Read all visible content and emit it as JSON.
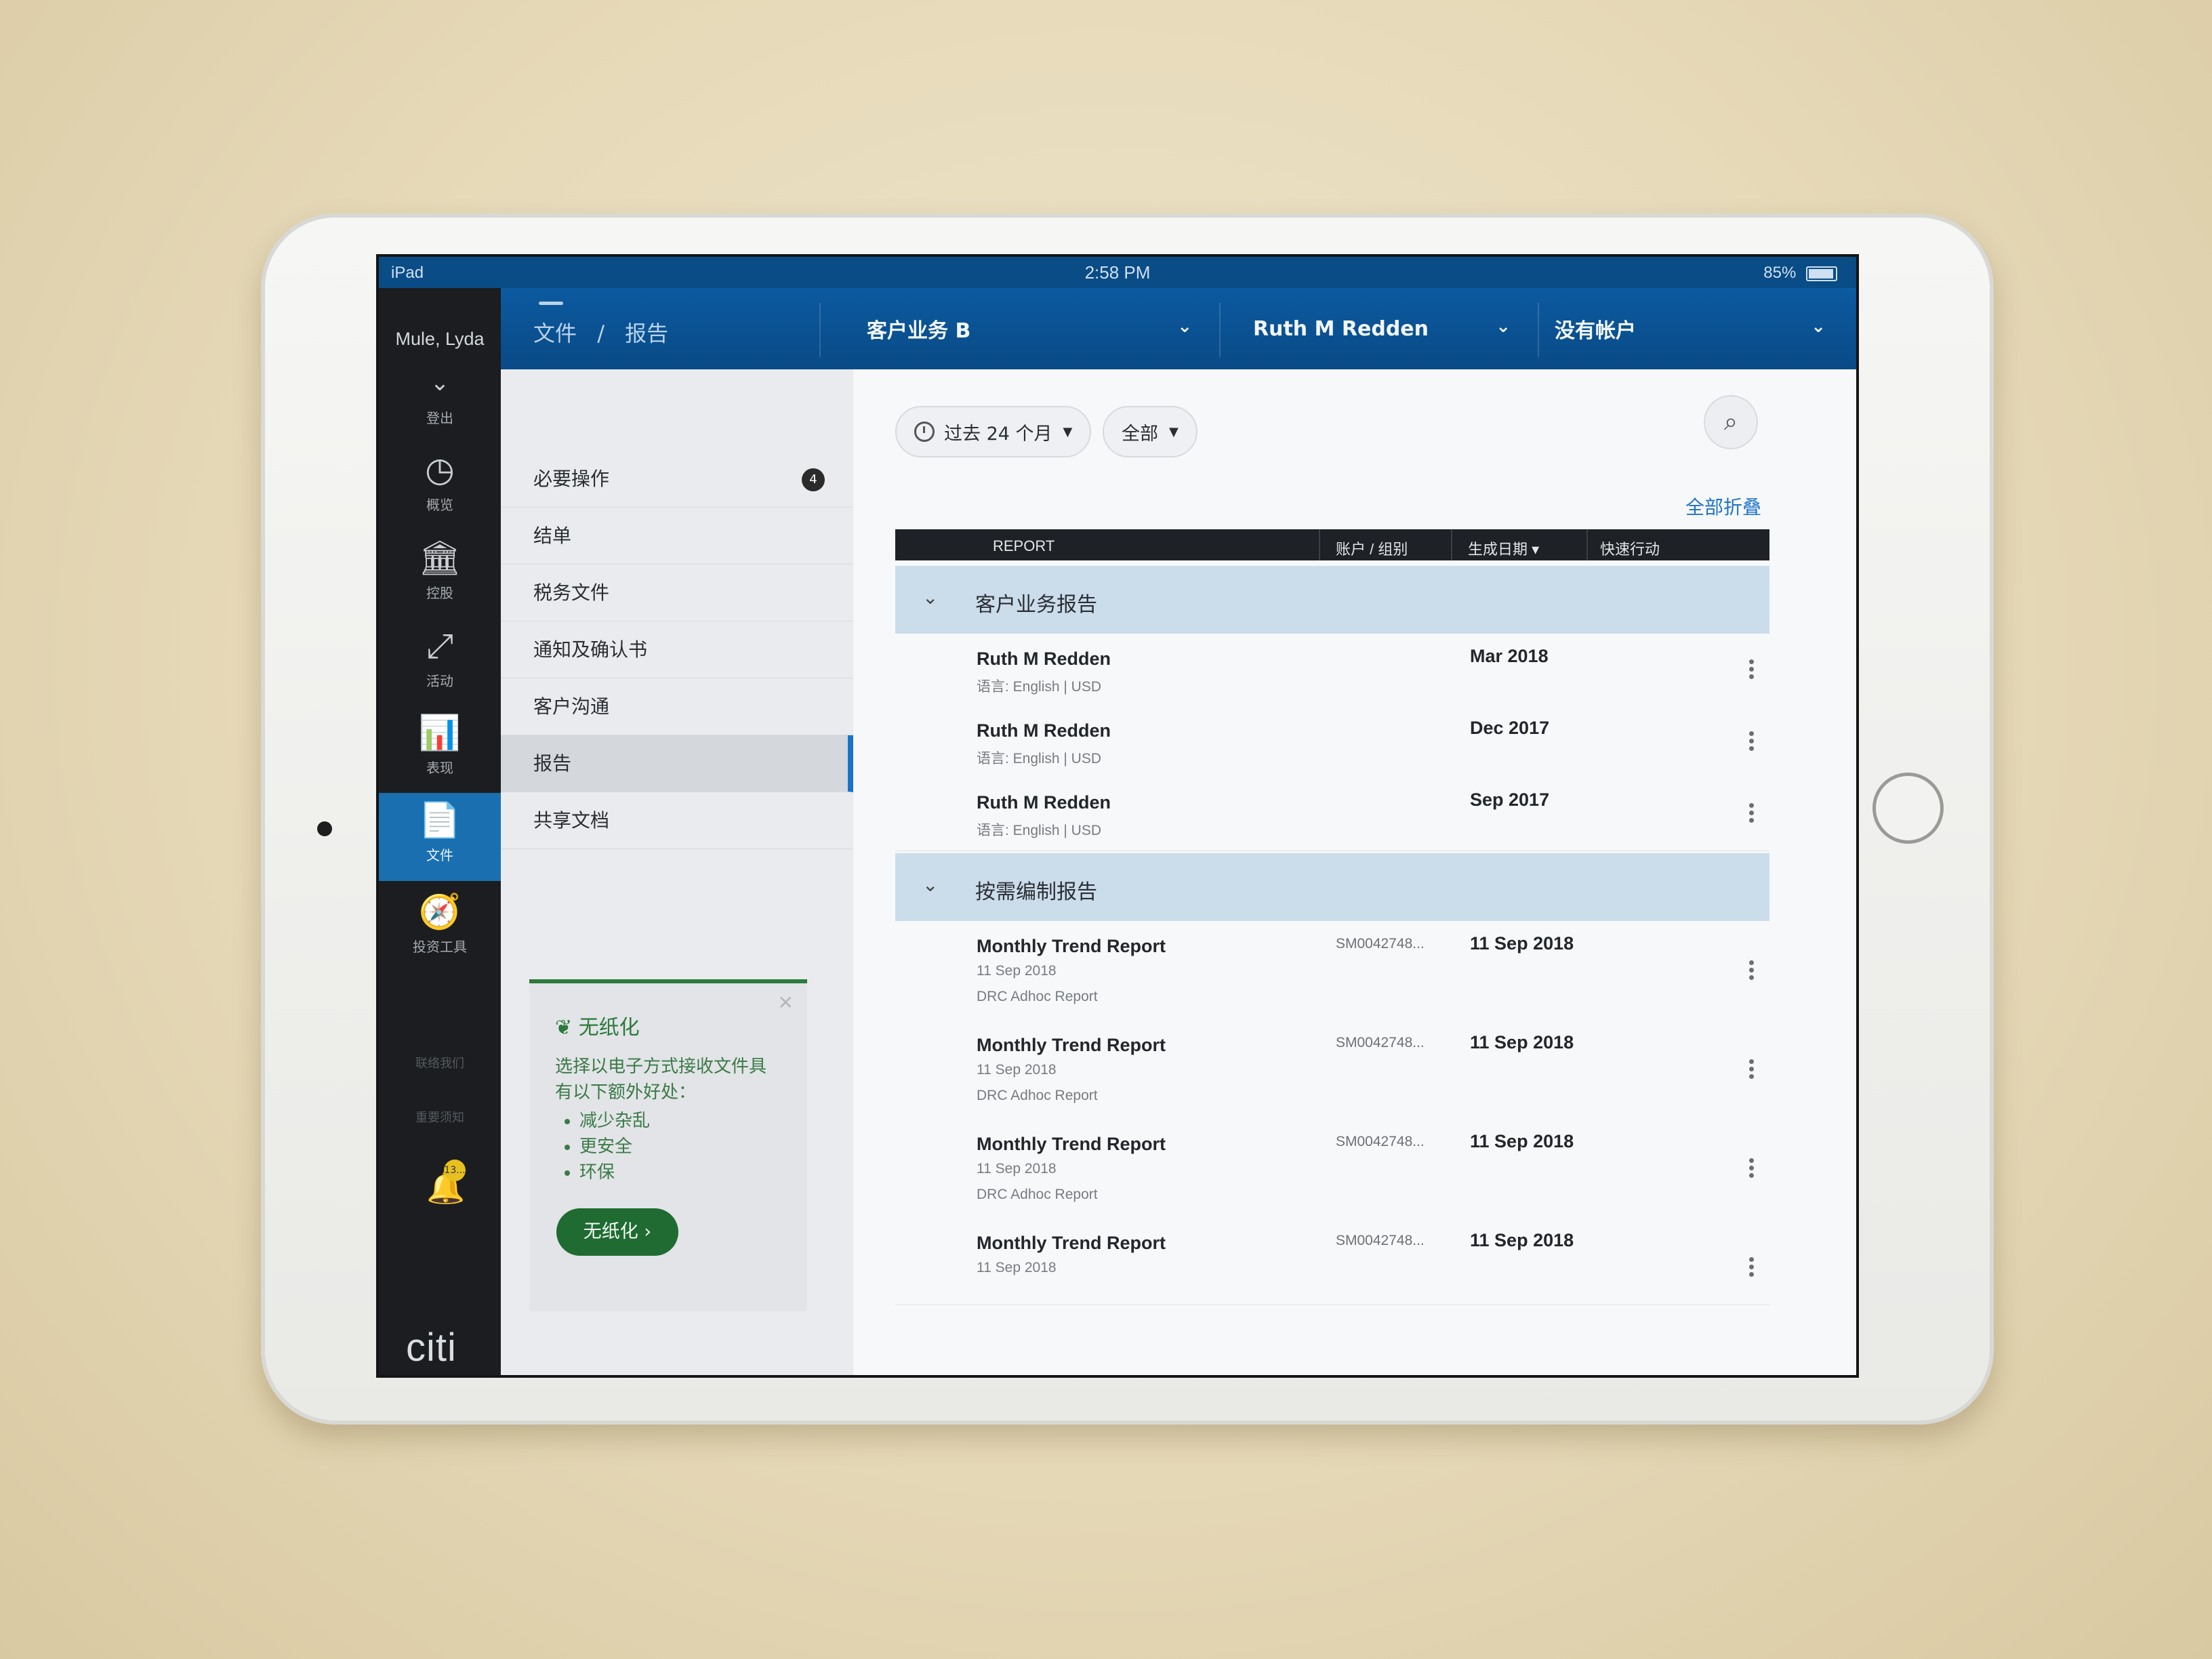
{
  "status_bar": {
    "device": "iPad",
    "time": "2:58 PM",
    "battery": "85%"
  },
  "header": {
    "breadcrumb": [
      "文件",
      "/",
      "报告"
    ],
    "selectors": [
      {
        "label": "客户业务 B"
      },
      {
        "label": "Ruth M Redden"
      },
      {
        "label": "没有帐户"
      }
    ]
  },
  "rail": {
    "user_name": "Mule, Lyda",
    "logout": "登出",
    "items": [
      {
        "label": "概览",
        "icon": "gauge-icon",
        "glyph": "◷"
      },
      {
        "label": "控股",
        "icon": "bank-icon",
        "glyph": "🏛"
      },
      {
        "label": "活动",
        "icon": "arrows-icon",
        "glyph": "⤢"
      },
      {
        "label": "表现",
        "icon": "bar-chart-icon",
        "glyph": "📊"
      },
      {
        "label": "文件",
        "icon": "document-icon",
        "glyph": "📄"
      },
      {
        "label": "投资工具",
        "icon": "compass-icon",
        "glyph": "🧭"
      }
    ],
    "contact": "联络我们",
    "notice": "重要须知",
    "bell_badge": "13...",
    "brand": "citi"
  },
  "menu": {
    "items": [
      {
        "label": "必要操作",
        "badge": "4"
      },
      {
        "label": "结单"
      },
      {
        "label": "税务文件"
      },
      {
        "label": "通知及确认书"
      },
      {
        "label": "客户沟通"
      },
      {
        "label": "报告"
      },
      {
        "label": "共享文档"
      }
    ],
    "active_index": 5
  },
  "promo": {
    "title": "无纸化",
    "body": "选择以电子方式接收文件具有以下额外好处：",
    "bullets": [
      "减少杂乱",
      "更安全",
      "环保"
    ],
    "button": "无纸化"
  },
  "filters": {
    "period": "过去 24 个月",
    "scope": "全部",
    "collapse_all": "全部折叠"
  },
  "table": {
    "columns": [
      "REPORT",
      "账户 / 组别",
      "生成日期",
      "快速行动"
    ],
    "groups": [
      {
        "label": "客户业务报告",
        "rows": [
          {
            "name": "Ruth M Redden",
            "sub1": "语言:  English | USD",
            "date": "Mar 2018"
          },
          {
            "name": "Ruth M Redden",
            "sub1": "语言:  English | USD",
            "date": "Dec 2017"
          },
          {
            "name": "Ruth M Redden",
            "sub1": "语言:  English | USD",
            "date": "Sep 2017"
          }
        ]
      },
      {
        "label": "按需编制报告",
        "rows": [
          {
            "name": "Monthly Trend Report",
            "sub1": "11 Sep 2018",
            "sub2": "DRC Adhoc Report",
            "account": "SM0042748...",
            "date": "11 Sep 2018"
          },
          {
            "name": "Monthly Trend Report",
            "sub1": "11 Sep 2018",
            "sub2": "DRC Adhoc Report",
            "account": "SM0042748...",
            "date": "11 Sep 2018"
          },
          {
            "name": "Monthly Trend Report",
            "sub1": "11 Sep 2018",
            "sub2": "DRC Adhoc Report",
            "account": "SM0042748...",
            "date": "11 Sep 2018"
          },
          {
            "name": "Monthly Trend Report",
            "sub1": "11 Sep 2018",
            "account": "SM0042748...",
            "date": "11 Sep 2018"
          }
        ]
      }
    ]
  }
}
